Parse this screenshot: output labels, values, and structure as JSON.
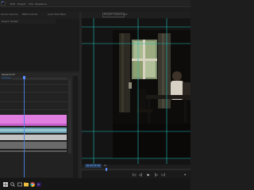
{
  "menubar": {
    "items": [
      "Edit",
      "Project",
      "Clip",
      "Sequence"
    ]
  },
  "workspace": {
    "source_tab": "Source: Sea.mov",
    "effect_controls_tab": "Effect Controls",
    "audio_mixer_tab": "Audio Track Mixer",
    "program_tab": "Program: Sequence 01",
    "project_tab": "Project: Untitled"
  },
  "timeline": {
    "sequence_tab": "Sequence 01"
  },
  "program": {
    "timecode": "00:00:00:00",
    "fit": "Fit"
  },
  "transport": {
    "buttons": [
      "|◁",
      "◁|",
      "▶",
      "|▷",
      "▷|",
      "+"
    ]
  },
  "colors": {
    "accent": "#5b8cff",
    "video_clip": "#e07fe0",
    "audio_clip_1": "#68a0b0",
    "audio_clip_2": "#c2c2c2"
  },
  "icons": [
    "windows-start-icon",
    "search-icon",
    "task-view-icon",
    "file-explorer-icon",
    "chrome-icon",
    "premiere-pro-icon"
  ]
}
